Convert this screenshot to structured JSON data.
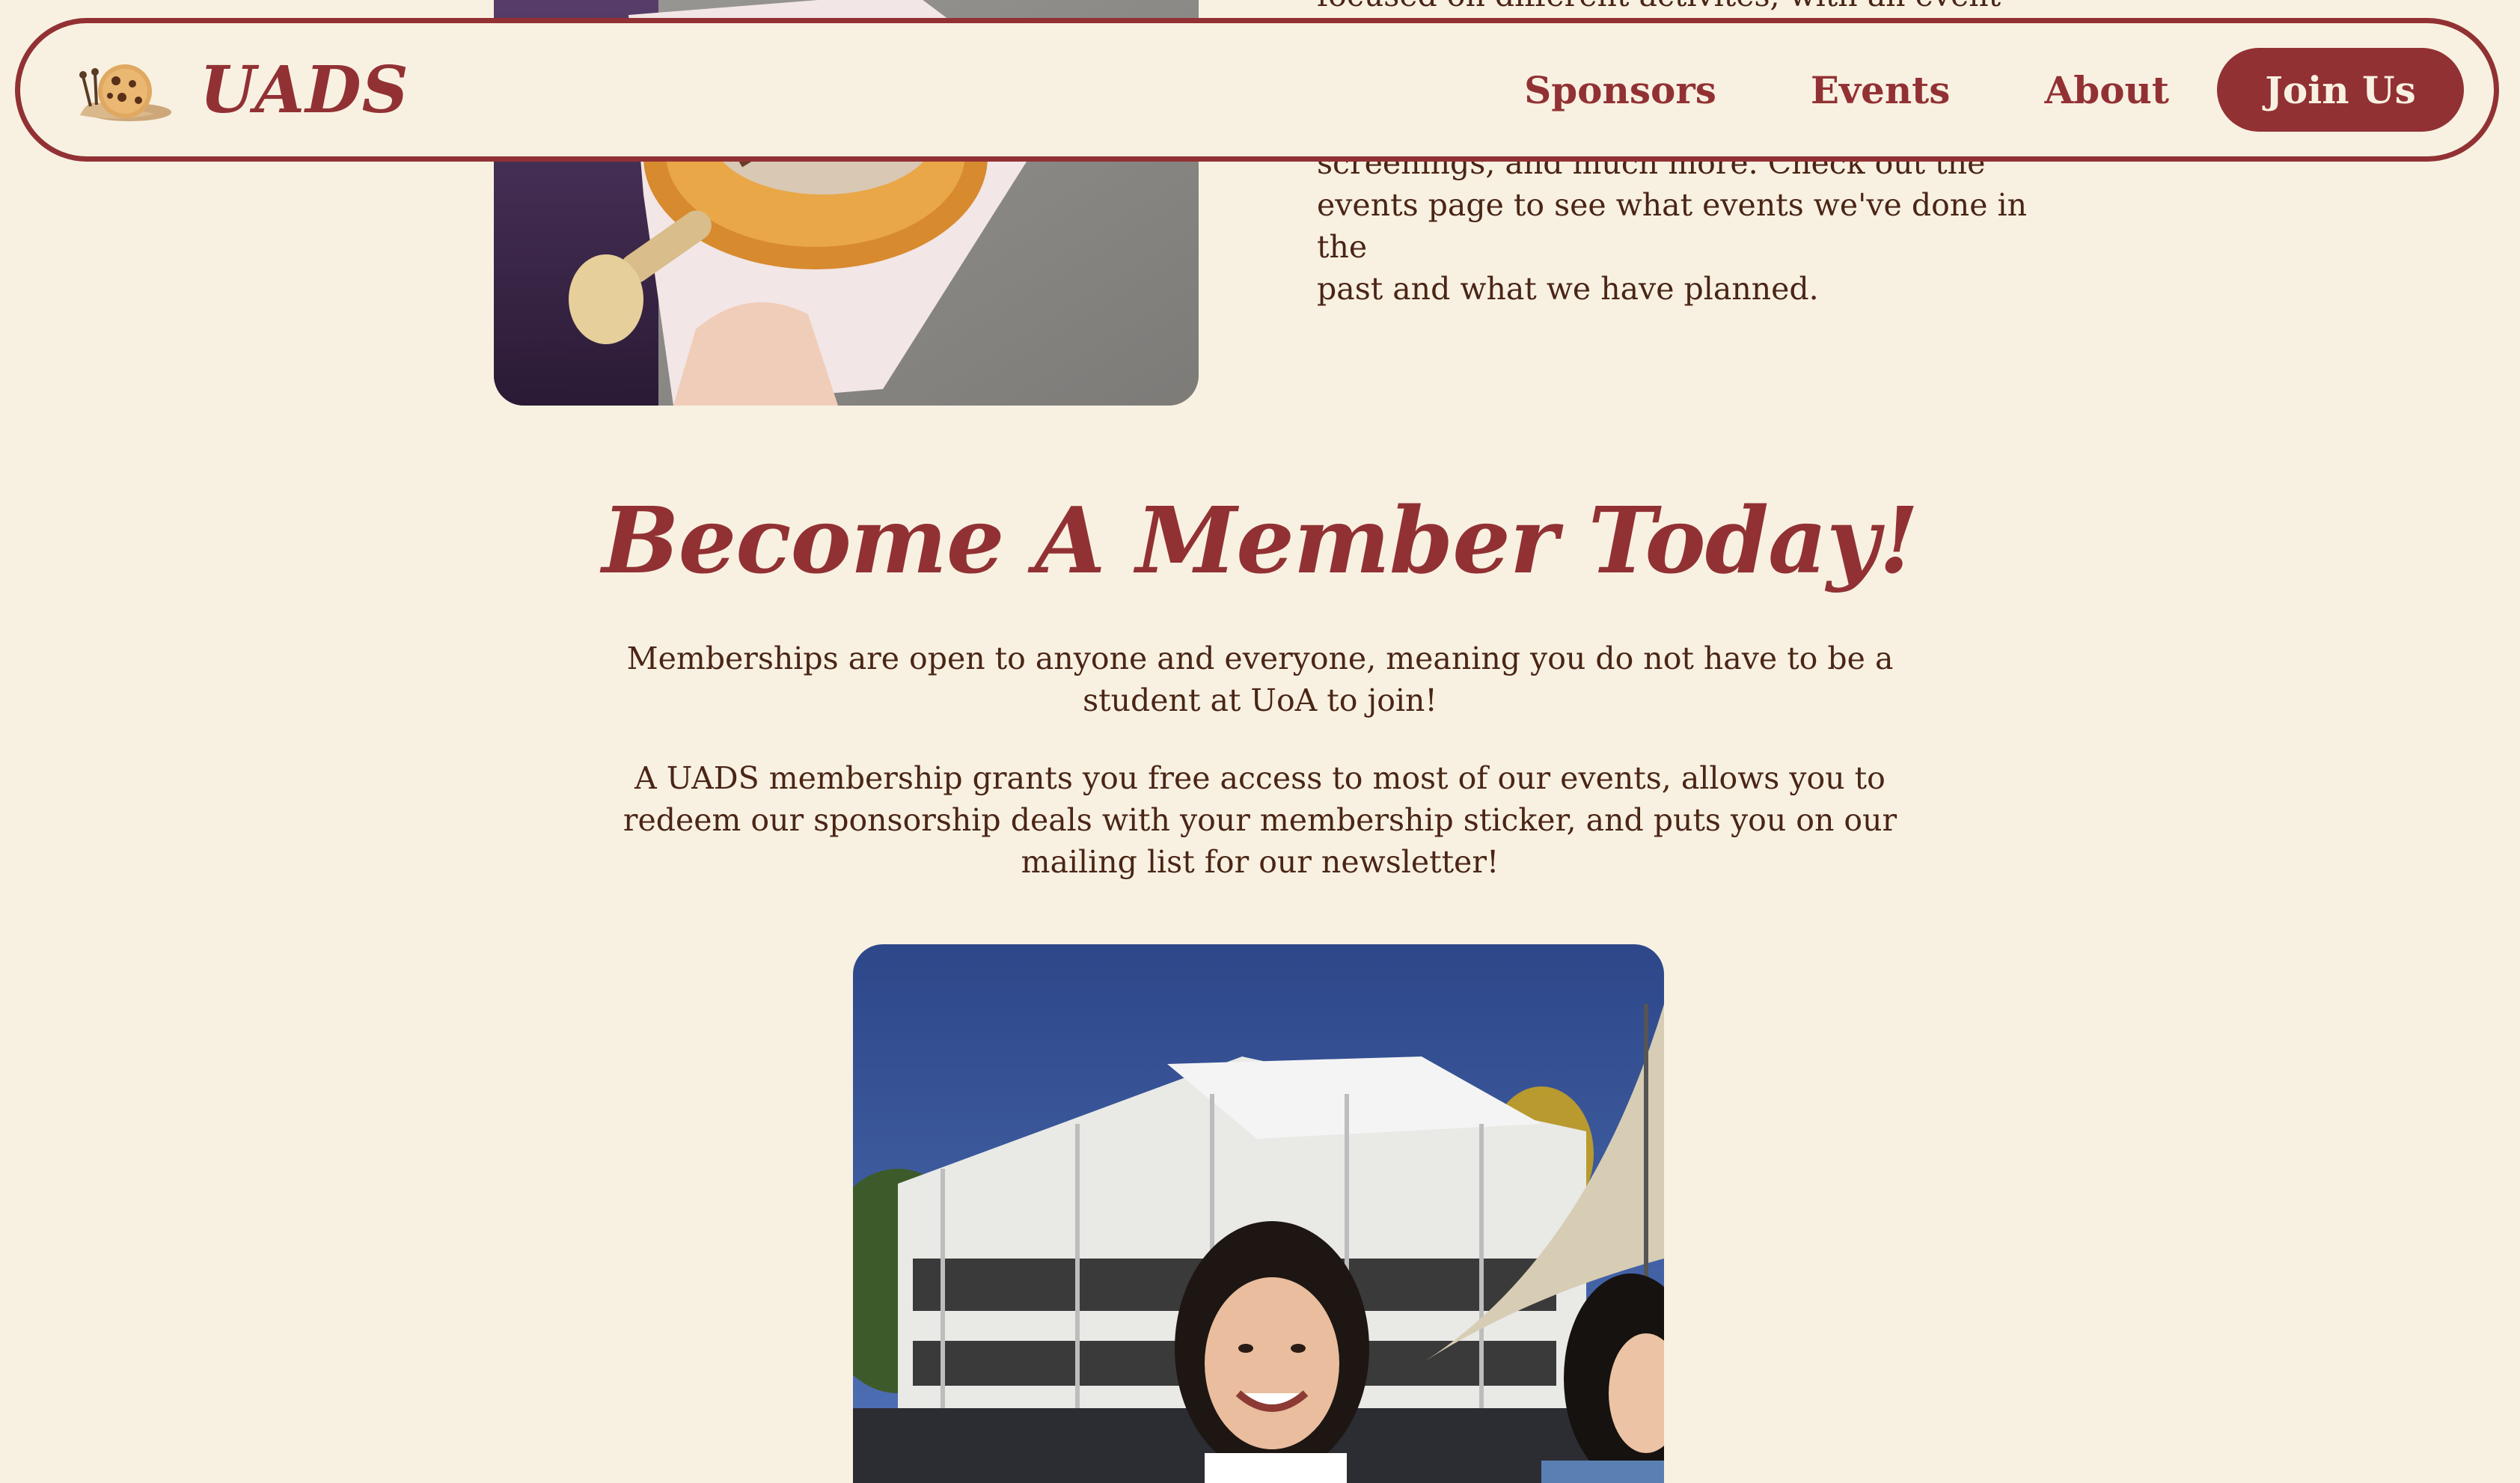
{
  "nav": {
    "brand_name": "UADS",
    "logo_icon": "snail-cookie-logo-icon",
    "links": [
      "Sponsors",
      "Events",
      "About"
    ],
    "cta_label": "Join Us"
  },
  "intro": {
    "lines": [
      "focused on different activites, with an event at",
      "screenings, and much more. Check out the",
      "events page to see what events we've done in the",
      "past and what we have planned."
    ]
  },
  "membership": {
    "heading": "Become A Member Today!",
    "paragraph_1": "Memberships are open to anyone and everyone, meaning you do not have to be a student at UoA to join!",
    "paragraph_2": "A UADS membership grants you free access to most of our events, allows you to redeem our sponsorship deals with your membership sticker, and puts you on our mailing list for our newsletter!"
  },
  "colors": {
    "background": "#f8f1e1",
    "brand": "#923134",
    "text": "#4a2516"
  }
}
